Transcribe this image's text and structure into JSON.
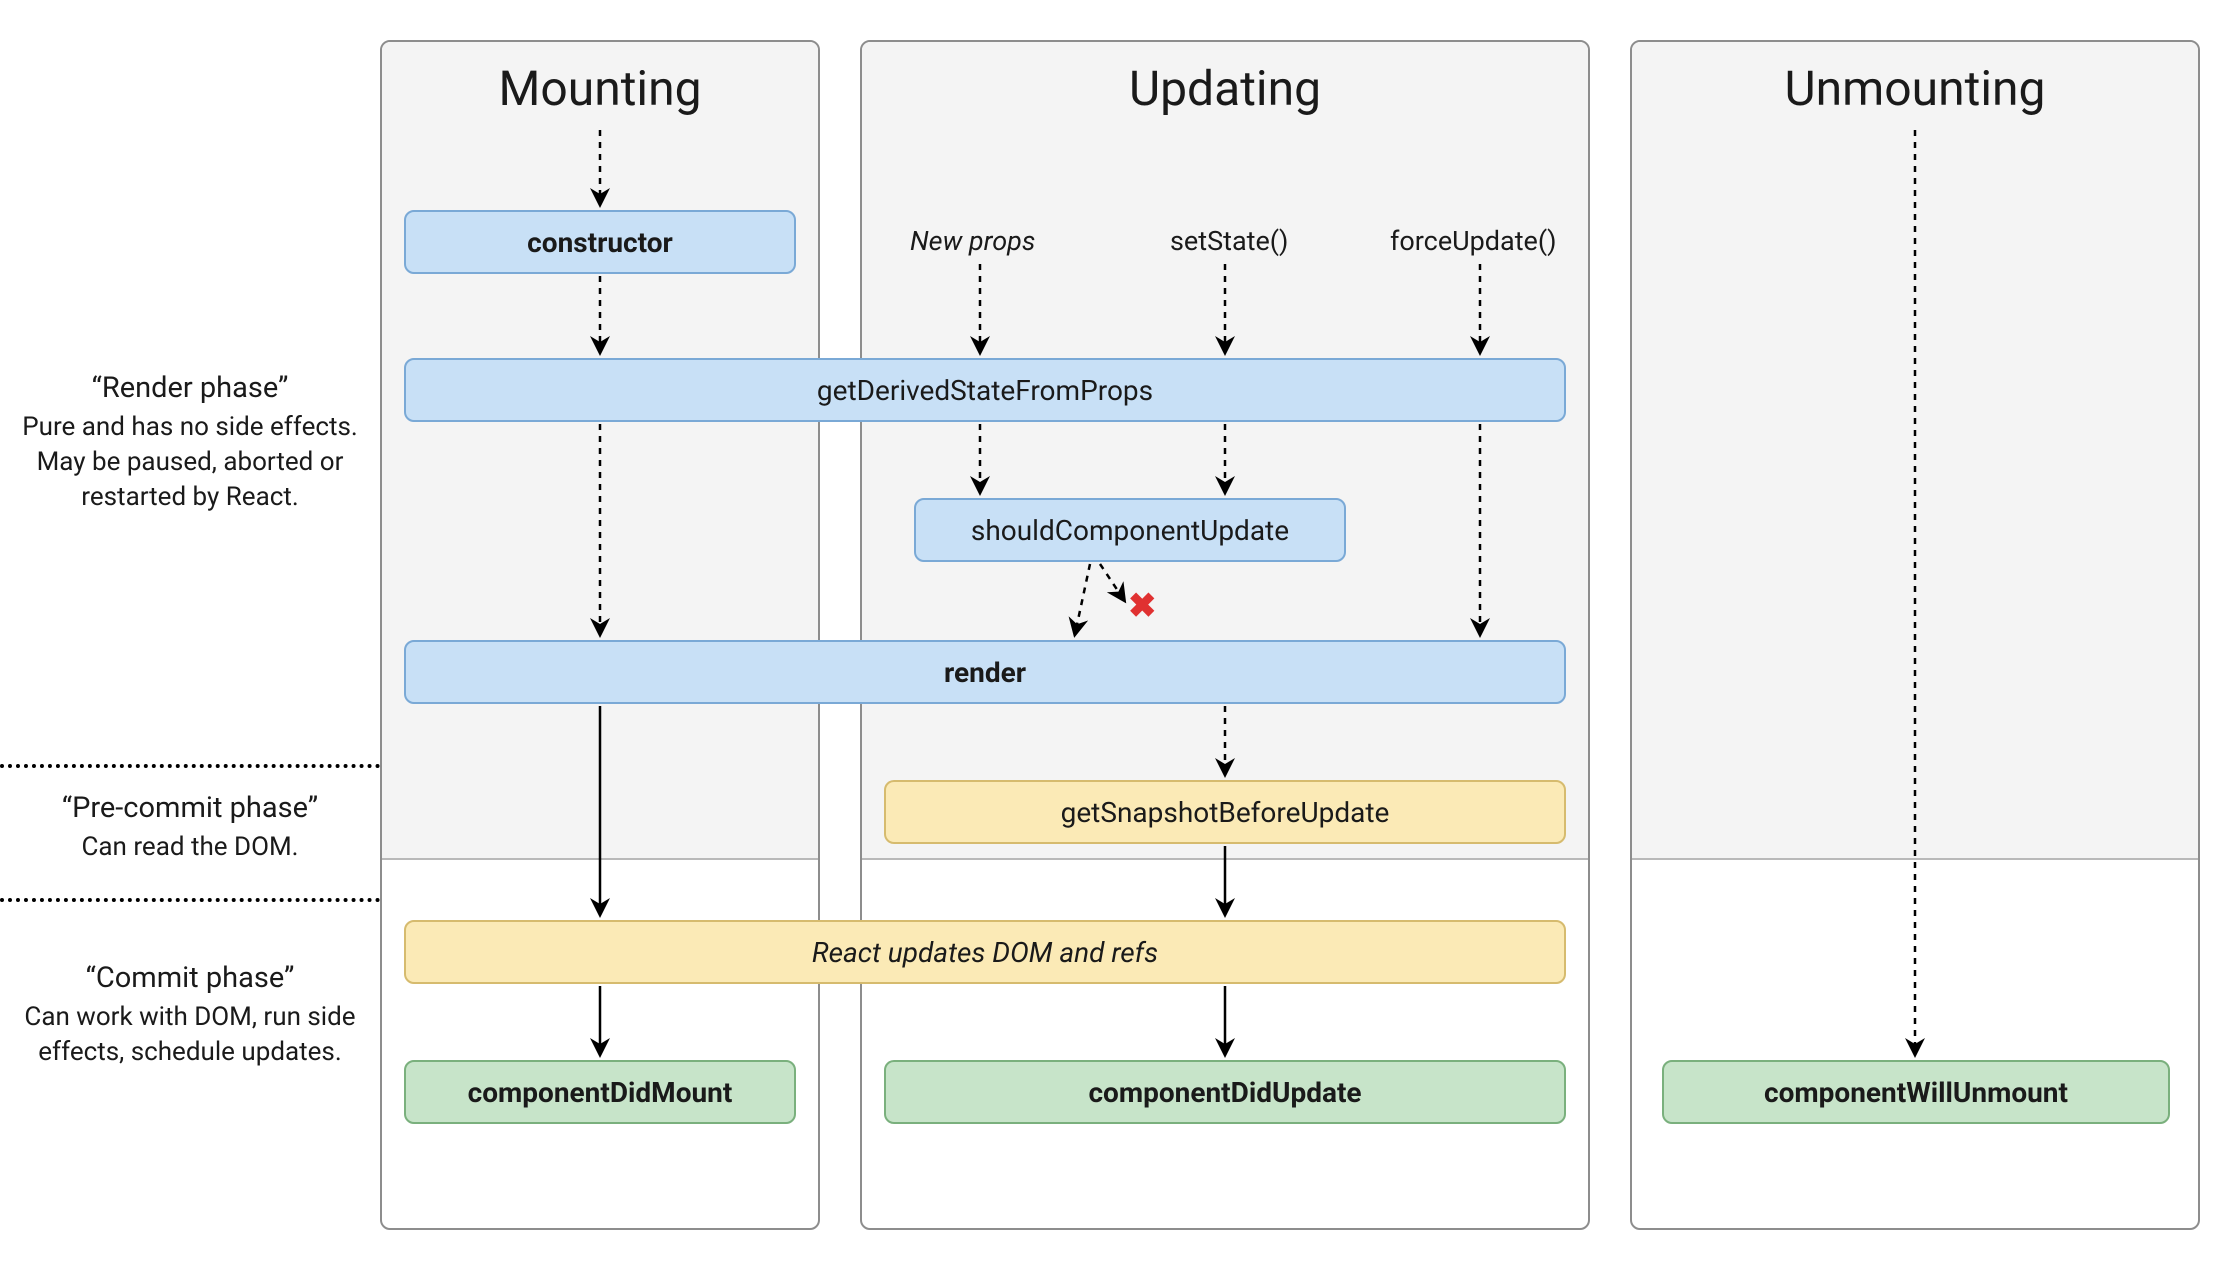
{
  "columns": {
    "mounting": {
      "title": "Mounting"
    },
    "updating": {
      "title": "Updating"
    },
    "unmounting": {
      "title": "Unmounting"
    }
  },
  "phases": {
    "render": {
      "title": "“Render phase”",
      "desc": "Pure and has no side effects. May be paused, aborted or restarted by React."
    },
    "precommit": {
      "title": "“Pre-commit phase”",
      "desc": "Can read the DOM."
    },
    "commit": {
      "title": "“Commit phase”",
      "desc": "Can work with DOM, run side effects, schedule updates."
    }
  },
  "boxes": {
    "constructor": "constructor",
    "getDerivedStateFromProps": "getDerivedStateFromProps",
    "shouldComponentUpdate": "shouldComponentUpdate",
    "render": "render",
    "getSnapshotBeforeUpdate": "getSnapshotBeforeUpdate",
    "reactUpdatesDom": "React updates DOM and refs",
    "componentDidMount": "componentDidMount",
    "componentDidUpdate": "componentDidUpdate",
    "componentWillUnmount": "componentWillUnmount"
  },
  "triggers": {
    "newProps": "New props",
    "setState": "setState()",
    "forceUpdate": "forceUpdate()"
  }
}
